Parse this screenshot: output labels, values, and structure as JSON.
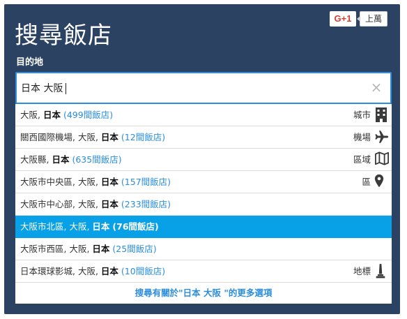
{
  "header": {
    "title": "搜尋飯店",
    "gplus_label": "G+1",
    "gplus_count": "上萬"
  },
  "search": {
    "label": "目的地",
    "value": "日本 大阪",
    "clear_glyph": "×"
  },
  "suggestions": [
    {
      "place": "大阪",
      "country": "日本",
      "count": "(499間飯店)",
      "type": "城市",
      "icon": "building-icon"
    },
    {
      "place": "關西國際機場, 大阪",
      "country": "日本",
      "count": "(12間飯店)",
      "type": "機場",
      "icon": "airplane-icon"
    },
    {
      "place": "大阪縣",
      "country": "日本",
      "count": "(635間飯店)",
      "type": "區域",
      "icon": "map-icon"
    },
    {
      "place": "大阪市中央區, 大阪",
      "country": "日本",
      "count": "(157間飯店)",
      "type": "區",
      "icon": "location-pin-icon"
    },
    {
      "place": "大阪市中心部, 大阪",
      "country": "日本",
      "count": "(233間飯店)",
      "type": "",
      "icon": ""
    },
    {
      "place": "大阪市北區, 大阪",
      "country": "日本",
      "count": "(76間飯店)",
      "type": "",
      "icon": "",
      "selected": true
    },
    {
      "place": "大阪市西區, 大阪",
      "country": "日本",
      "count": "(25間飯店)",
      "type": "",
      "icon": ""
    },
    {
      "place": "日本環球影城, 大阪",
      "country": "日本",
      "count": "(10間飯店)",
      "type": "地標",
      "icon": "landmark-icon"
    }
  ],
  "more_link": "搜尋有關於\"日本 大阪 \"的更多選項",
  "colors": {
    "panel": "#2c4263",
    "accent": "#2a8ddf",
    "selected_row": "#08a0e6"
  }
}
